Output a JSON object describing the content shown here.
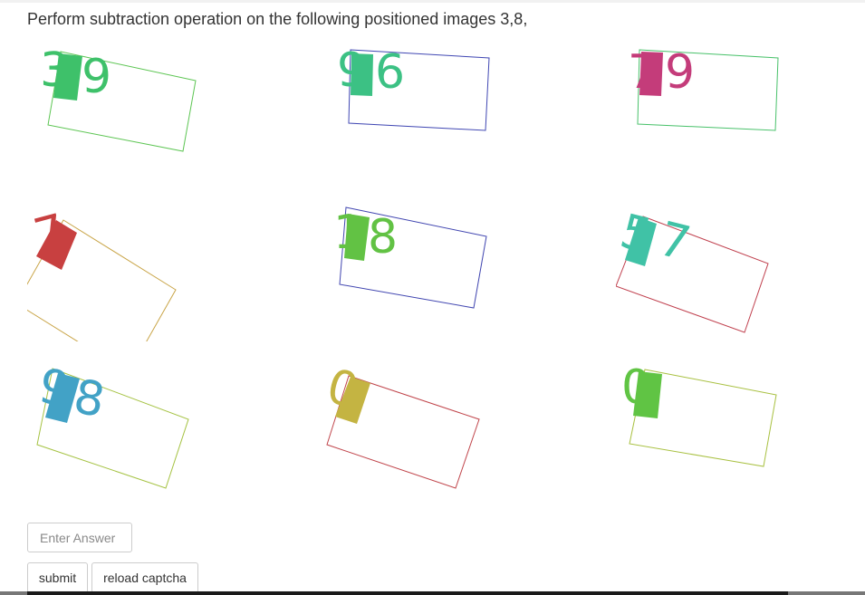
{
  "prompt": {
    "text": "Perform subtraction operation on the following positioned images 3,8,"
  },
  "tiles": [
    {
      "position": 1,
      "digits": [
        "3",
        "9"
      ],
      "digit_colors": [
        "#3ec16a",
        "#3ec16a"
      ],
      "box_color": "#5cc552",
      "patch_color": "#3ec16a"
    },
    {
      "position": 2,
      "digits": [
        "9",
        "6"
      ],
      "digit_colors": [
        "#3cc184",
        "#3cc184"
      ],
      "box_color": "#4047b3",
      "patch_color": "#3cc184"
    },
    {
      "position": 3,
      "digits": [
        "7",
        "9"
      ],
      "digit_colors": [
        "#c43c7a",
        "#c43c7a"
      ],
      "box_color": "#48c16a",
      "patch_color": "#c43c7a"
    },
    {
      "position": 4,
      "digits": [
        "7"
      ],
      "digit_colors": [
        "#c84040"
      ],
      "box_color": "#c9a548",
      "patch_color": "#c84040"
    },
    {
      "position": 5,
      "digits": [
        "1",
        "8"
      ],
      "digit_colors": [
        "#62c244",
        "#62c244"
      ],
      "box_color": "#4045b0",
      "patch_color": "#62c244"
    },
    {
      "position": 6,
      "digits": [
        "5",
        "7"
      ],
      "digit_colors": [
        "#40c2a6",
        "#40c2a6"
      ],
      "box_color": "#c0404e",
      "patch_color": "#40c2a6"
    },
    {
      "position": 7,
      "digits": [
        "9",
        "8"
      ],
      "digit_colors": [
        "#42a2c6",
        "#42a2c6"
      ],
      "box_color": "#a5c242",
      "patch_color": "#42a2c6"
    },
    {
      "position": 8,
      "digits": [
        "0"
      ],
      "digit_colors": [
        "#c4b442"
      ],
      "box_color": "#c0444a",
      "patch_color": "#c4b442"
    },
    {
      "position": 9,
      "digits": [
        "0"
      ],
      "digit_colors": [
        "#60c444"
      ],
      "box_color": "#a8c040",
      "patch_color": "#60c444"
    }
  ],
  "form": {
    "answer_placeholder": "Enter Answer",
    "answer_value": "",
    "submit_label": "submit",
    "reload_label": "reload captcha"
  }
}
